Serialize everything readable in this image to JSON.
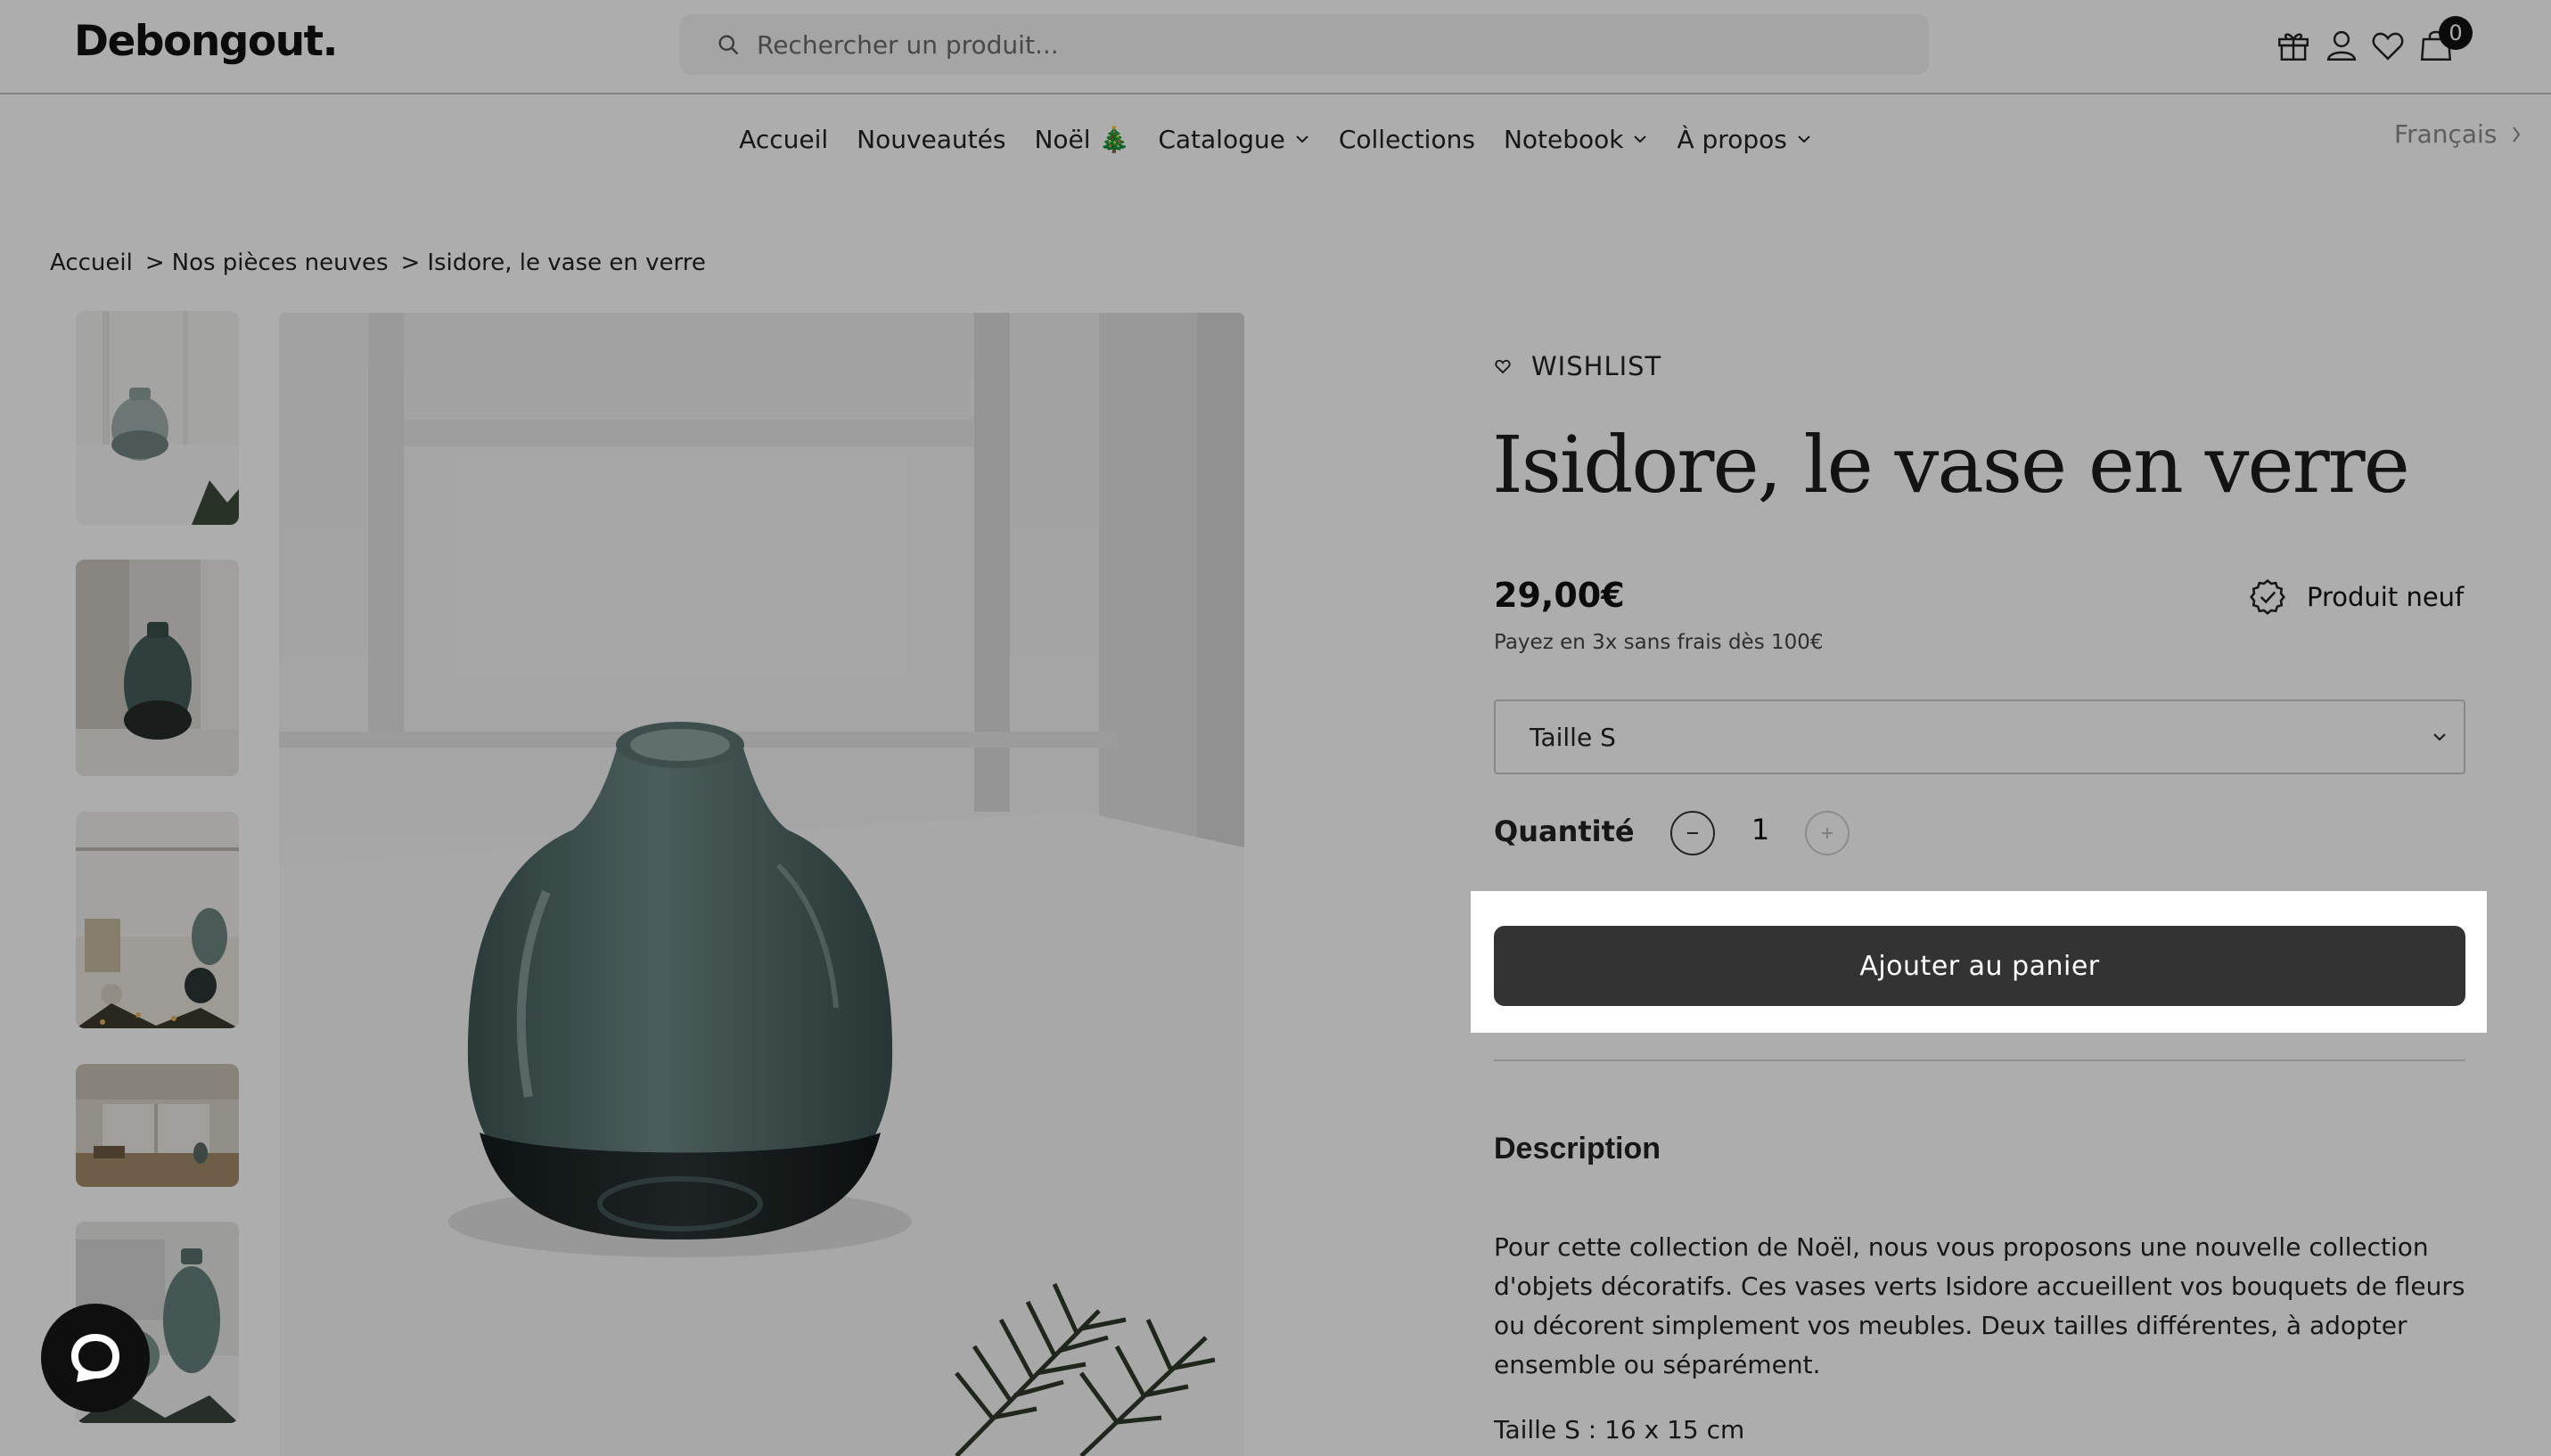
{
  "header": {
    "logo": "Debongout.",
    "search_placeholder": "Rechercher un produit...",
    "icons": [
      "gift-icon",
      "user-icon",
      "heart-icon",
      "bag-icon"
    ],
    "cart_count": "0"
  },
  "nav": {
    "items": [
      {
        "label": "Accueil"
      },
      {
        "label": "Nouveautés"
      },
      {
        "label": "Noël 🎄"
      },
      {
        "label": "Catalogue"
      },
      {
        "label": "Collections"
      },
      {
        "label": "Notebook"
      },
      {
        "label": "À propos"
      }
    ],
    "language": "Français"
  },
  "breadcrumb": {
    "items": [
      "Accueil",
      "Nos pièces neuves",
      "Isidore, le vase en verre"
    ],
    "separator": ">"
  },
  "product": {
    "wishlist_label": "WISHLIST",
    "title": "Isidore, le vase en verre",
    "price": "29,00€",
    "installments": "Payez en 3x sans frais dès 100€",
    "condition_badge": "Produit neuf",
    "size_selected": "Taille S",
    "quantity_label": "Quantité",
    "quantity_value": "1",
    "add_to_cart": "Ajouter au panier",
    "description_title": "Description",
    "description_text": "Pour cette collection de Noël, nous vous proposons une nouvelle collection d'objets décoratifs. Ces vases verts Isidore accueillent vos bouquets de fleurs ou décorent simplement vos meubles. Deux tailles différentes, à adopter ensemble ou séparément.",
    "size_info": "Taille S : 16 x 15 cm"
  },
  "colors": {
    "button_bg": "#333333",
    "overlay": "rgba(0,0,0,0.32)",
    "vase_glass": "#3f5a58",
    "accent_text": "#222222"
  }
}
